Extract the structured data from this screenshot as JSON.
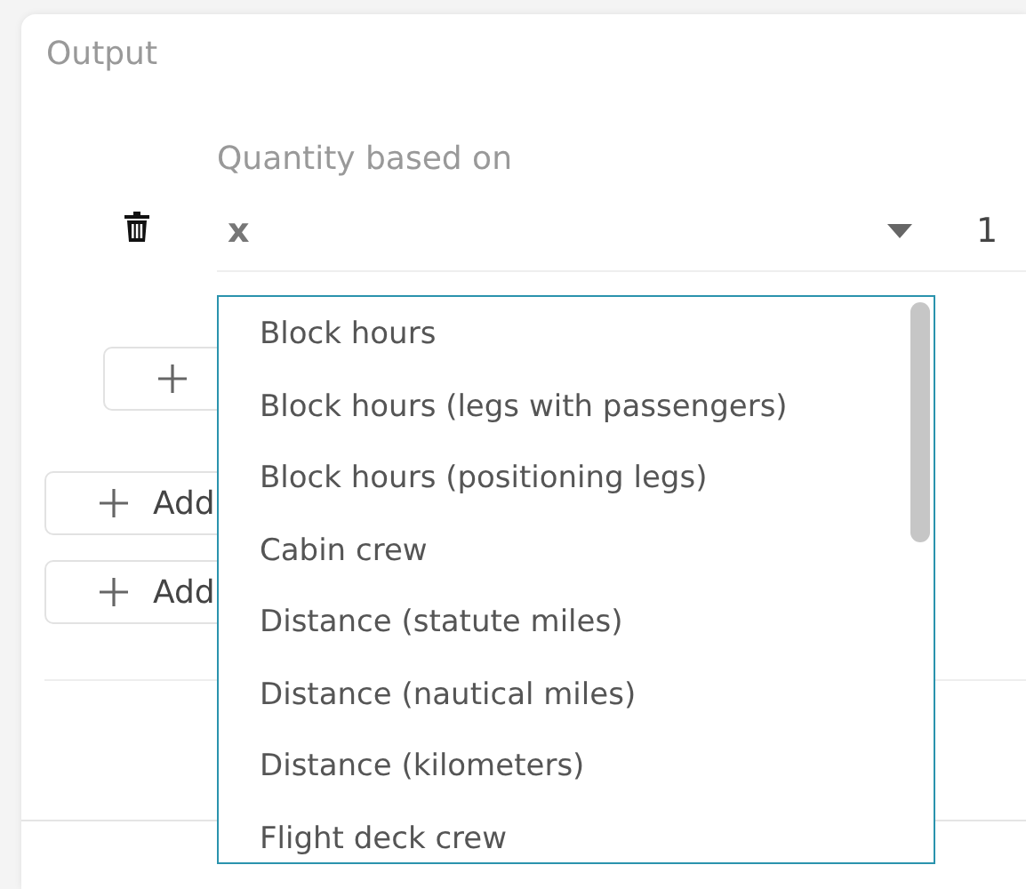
{
  "section": {
    "title": "Output"
  },
  "quantity": {
    "label": "Quantity based on",
    "value": "x",
    "number": "1"
  },
  "buttons": [
    {
      "kind": "nested"
    },
    {
      "kind": "section",
      "label": "Add"
    },
    {
      "kind": "section",
      "label": "Add"
    }
  ],
  "dropdown": {
    "options": [
      {
        "label": "Block hours"
      },
      {
        "label": "Block hours (legs with passengers)"
      },
      {
        "label": "Block hours (positioning legs)"
      },
      {
        "label": "Cabin crew"
      },
      {
        "label": "Distance (statute miles)"
      },
      {
        "label": "Distance (nautical miles)"
      },
      {
        "label": "Distance (kilometers)"
      },
      {
        "label": "Flight deck crew"
      }
    ]
  }
}
